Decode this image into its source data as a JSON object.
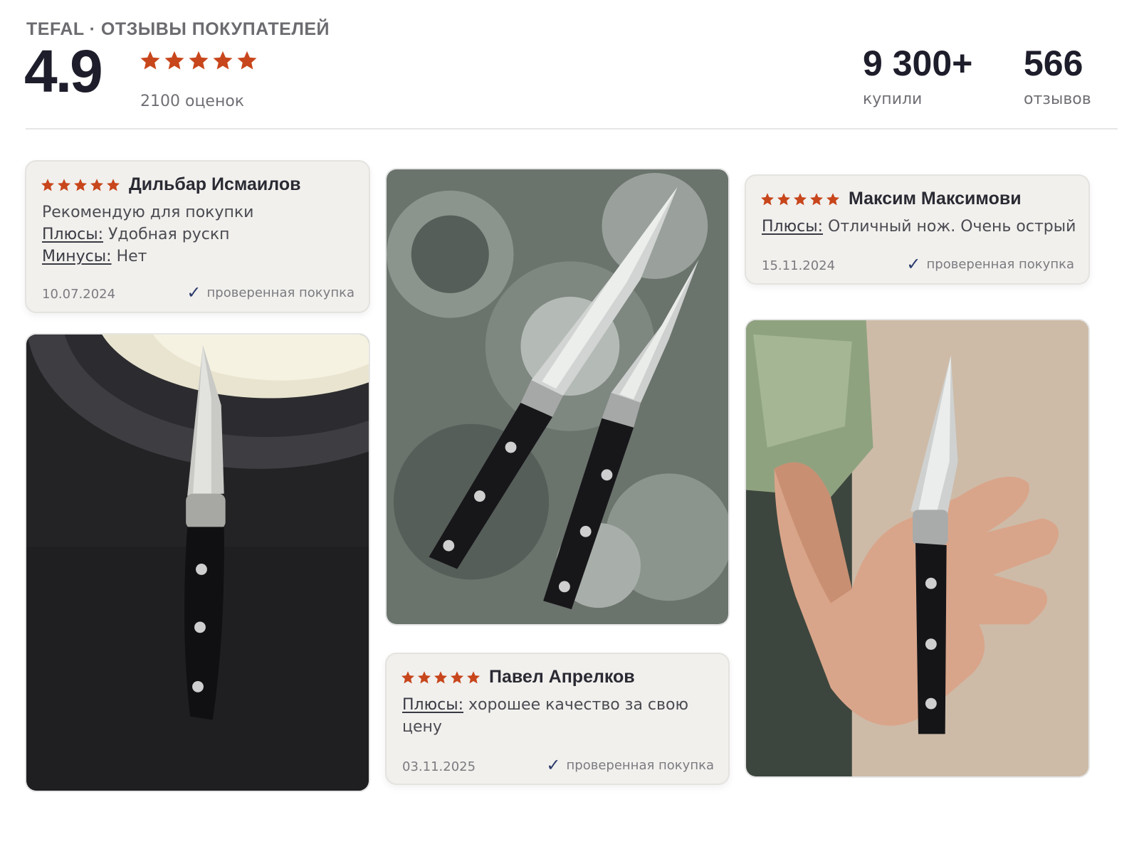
{
  "header": {
    "brand": "TEFAL · ОТЗЫВЫ ПОКУПАТЕЛЕЙ",
    "score": "4.9",
    "ratings_count": "2100 оценок",
    "stars": 5,
    "stats": [
      {
        "value": "9 300+",
        "label": "купили"
      },
      {
        "value": "566",
        "label": "отзывов"
      }
    ]
  },
  "colors": {
    "star": "#c8461c",
    "check": "#2b3a6b"
  },
  "reviews": [
    {
      "stars": 5,
      "name": "Дильбар Исмаилов",
      "comment": "Рекомендую для покупки",
      "pros_label": "Плюсы:",
      "pros": "Удобная рускп",
      "cons_label": "Минусы:",
      "cons": "Нет",
      "date": "10.07.2024",
      "verified": "проверенная покупка"
    },
    {
      "stars": 5,
      "name": "Максим Максимови",
      "pros_label": "Плюсы:",
      "pros": "Отличный нож. Очень острый",
      "date": "15.11.2024",
      "verified": "проверенная покупка"
    },
    {
      "stars": 5,
      "name": "Павел Апрелков",
      "pros_label": "Плюсы:",
      "pros": "хорошее качество за свою цену",
      "date": "03.11.2025",
      "verified": "проверенная покупка"
    }
  ],
  "photos": [
    {
      "icon": "knife-photo-on-counter"
    },
    {
      "icon": "two-knives-photo-on-floral-cloth"
    },
    {
      "icon": "knife-in-hand-photo"
    }
  ]
}
